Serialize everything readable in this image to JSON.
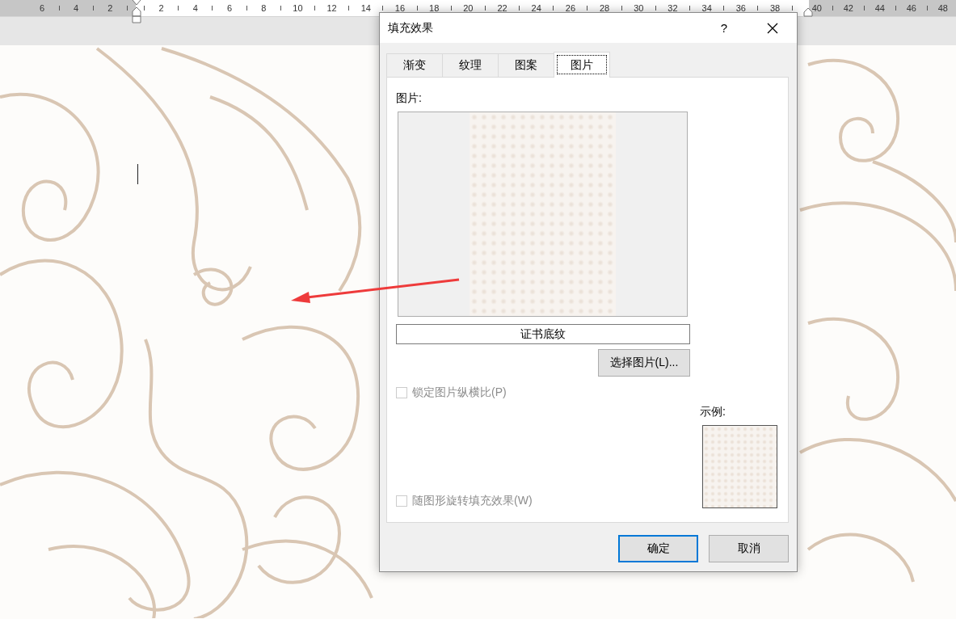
{
  "ruler": {
    "left_numbers": [
      "6",
      "4",
      "2"
    ],
    "numbers": [
      "2",
      "4",
      "6",
      "8",
      "10",
      "12",
      "14",
      "16",
      "18",
      "20",
      "22",
      "24",
      "26",
      "28",
      "30",
      "32",
      "34",
      "36",
      "38"
    ],
    "right_numbers": [
      "40",
      "42",
      "44",
      "46",
      "48"
    ]
  },
  "dialog": {
    "title": "填充效果",
    "help": "?",
    "tabs": [
      {
        "label": "渐变",
        "selected": false
      },
      {
        "label": "纹理",
        "selected": false
      },
      {
        "label": "图案",
        "selected": false
      },
      {
        "label": "图片",
        "selected": true
      }
    ],
    "picture_label": "图片:",
    "picture_name": "证书底纹",
    "select_button": "选择图片(L)...",
    "checkboxes": [
      {
        "label": "锁定图片纵横比(P)",
        "checked": false,
        "disabled": true
      },
      {
        "label": "随图形旋转填充效果(W)",
        "checked": false,
        "disabled": true
      }
    ],
    "sample_label": "示例:",
    "buttons": [
      {
        "label": "确定",
        "default": true
      },
      {
        "label": "取消",
        "default": false
      }
    ]
  }
}
